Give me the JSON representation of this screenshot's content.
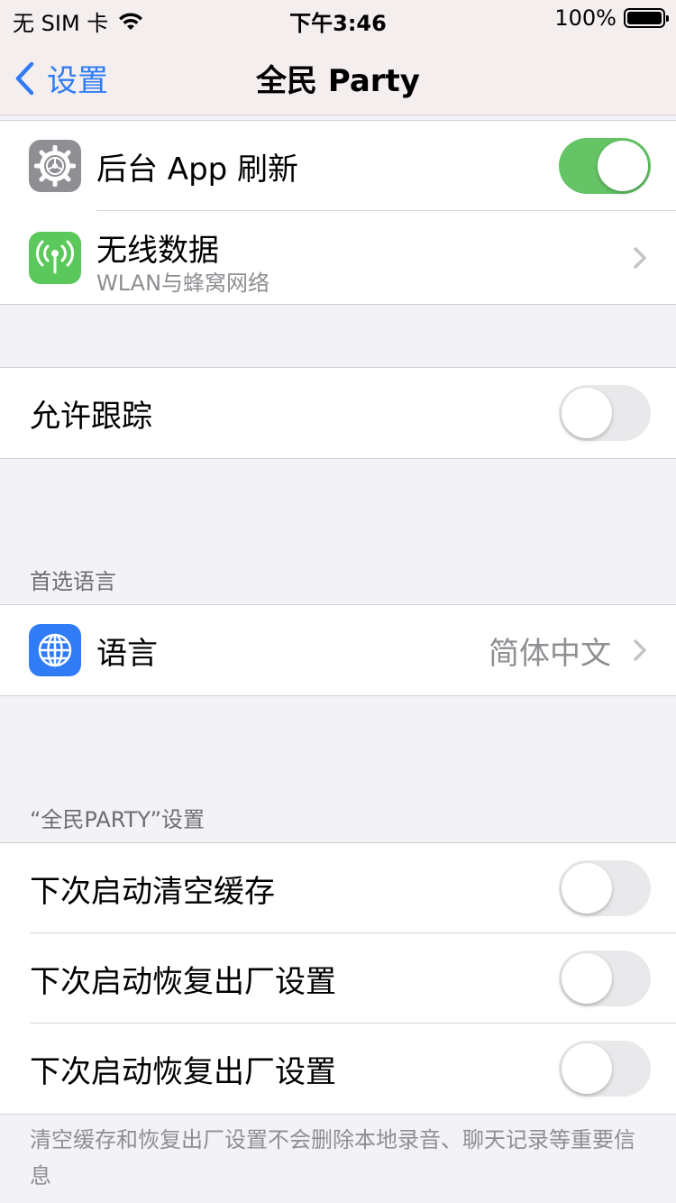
{
  "status_bar": {
    "carrier": "无 SIM 卡",
    "time": "下午3:46",
    "battery": "100%"
  },
  "nav": {
    "back_label": "设置",
    "title": "全民 Party"
  },
  "group1": {
    "background_refresh": {
      "label": "后台 App 刷新",
      "on": true
    },
    "wireless_data": {
      "label": "无线数据",
      "sublabel": "WLAN与蜂窝网络"
    }
  },
  "group2": {
    "allow_tracking": {
      "label": "允许跟踪",
      "on": false
    }
  },
  "language_section": {
    "header": "首选语言",
    "language": {
      "label": "语言",
      "value": "简体中文"
    }
  },
  "app_section": {
    "header": "“全民PARTY”设置",
    "items": [
      {
        "label": "下次启动清空缓存",
        "on": false
      },
      {
        "label": "下次启动恢复出厂设置",
        "on": false
      },
      {
        "label": "下次启动恢复出厂设置",
        "on": false
      }
    ],
    "footer": "清空缓存和恢复出厂设置不会删除本地录音、聊天记录等重要信息"
  },
  "colors": {
    "accent": "#2f7cf6",
    "toggle_on": "#65c466",
    "gear_icon_bg": "#8e8e93",
    "antenna_icon_bg": "#5ac85a",
    "globe_icon_bg": "#2f7cf6"
  }
}
